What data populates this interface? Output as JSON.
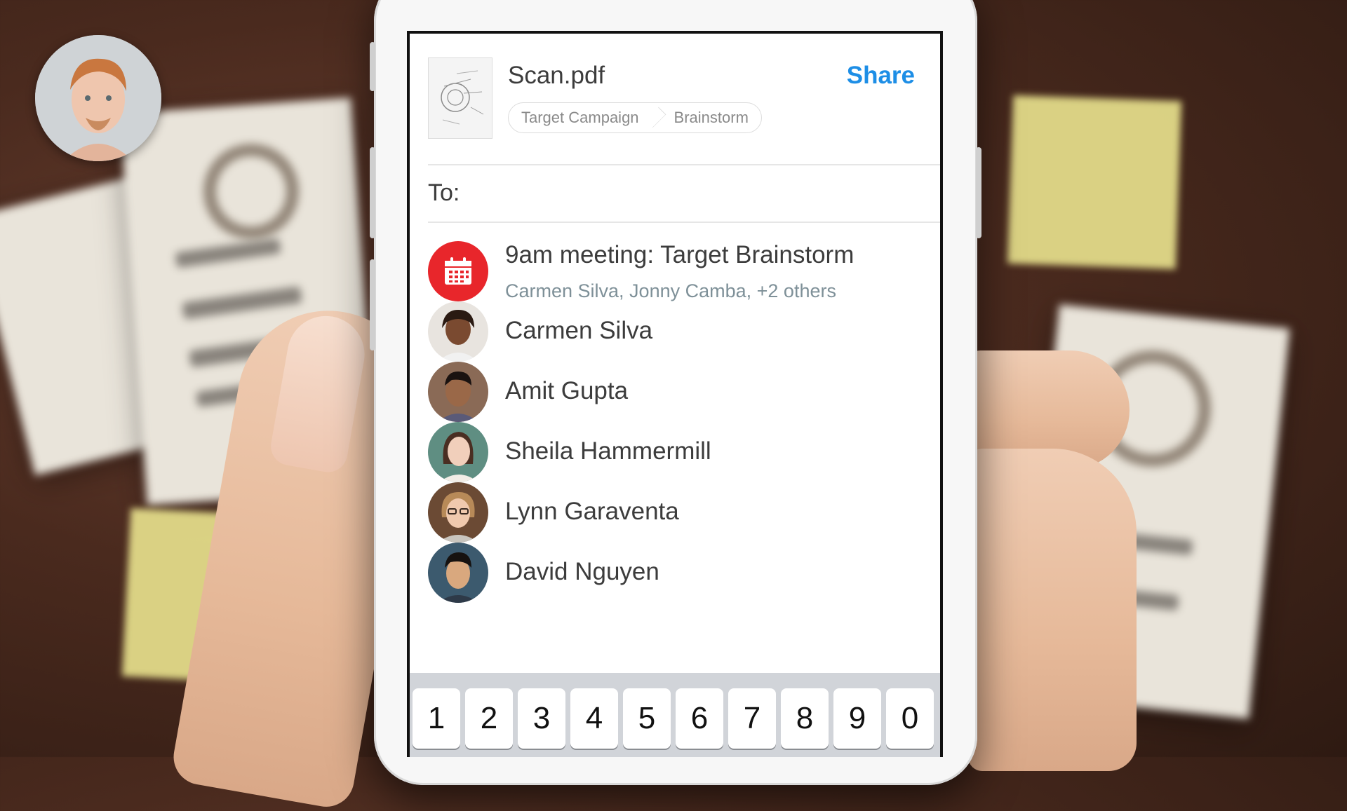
{
  "file": {
    "name": "Scan.pdf",
    "share_label": "Share",
    "breadcrumbs": [
      "Target Campaign",
      "Brainstorm"
    ]
  },
  "recipient": {
    "to_label": "To:",
    "value": ""
  },
  "suggestions": [
    {
      "name": "9am meeting: Target Brainstorm",
      "sub": "Carmen Silva, Jonny Camba, +2 others",
      "icon": "calendar-icon",
      "color": "#e8262b"
    },
    {
      "name": "Carmen Silva"
    },
    {
      "name": "Amit Gupta"
    },
    {
      "name": "Sheila Hammermill"
    },
    {
      "name": "Lynn Garaventa"
    },
    {
      "name": "David Nguyen"
    }
  ],
  "keyboard": {
    "keys": [
      "1",
      "2",
      "3",
      "4",
      "5",
      "6",
      "7",
      "8",
      "9",
      "0"
    ]
  },
  "colors": {
    "accent": "#1d8ee6",
    "calendar": "#e8262b"
  }
}
